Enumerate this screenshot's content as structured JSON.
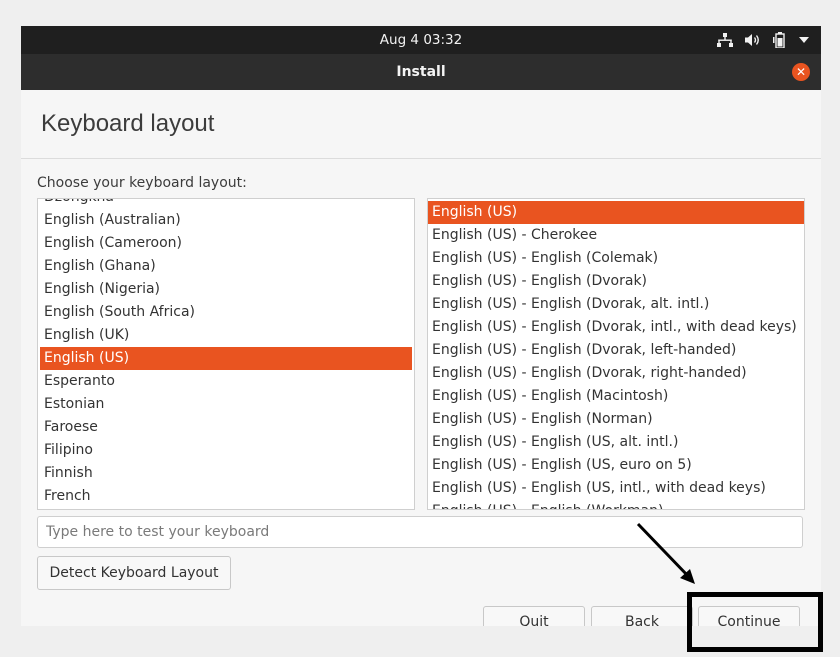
{
  "topbar": {
    "clock": "Aug 4  03:32",
    "icons": [
      "network-icon",
      "volume-icon",
      "battery-icon",
      "system-menu-chevron-icon"
    ]
  },
  "titlebar": {
    "title": "Install",
    "close_icon": "close-icon"
  },
  "page": {
    "title": "Keyboard layout",
    "prompt": "Choose your keyboard layout:"
  },
  "layouts": {
    "items": [
      "Dzongkha",
      "English (Australian)",
      "English (Cameroon)",
      "English (Ghana)",
      "English (Nigeria)",
      "English (South Africa)",
      "English (UK)",
      "English (US)",
      "Esperanto",
      "Estonian",
      "Faroese",
      "Filipino",
      "Finnish",
      "French"
    ],
    "selected": "English (US)"
  },
  "variants": {
    "items": [
      "English (US)",
      "English (US) - Cherokee",
      "English (US) - English (Colemak)",
      "English (US) - English (Dvorak)",
      "English (US) - English (Dvorak, alt. intl.)",
      "English (US) - English (Dvorak, intl., with dead keys)",
      "English (US) - English (Dvorak, left-handed)",
      "English (US) - English (Dvorak, right-handed)",
      "English (US) - English (Macintosh)",
      "English (US) - English (Norman)",
      "English (US) - English (US, alt. intl.)",
      "English (US) - English (US, euro on 5)",
      "English (US) - English (US, intl., with dead keys)",
      "English (US) - English (Workman)"
    ],
    "selected": "English (US)"
  },
  "test_input": {
    "placeholder": "Type here to test your keyboard",
    "value": ""
  },
  "buttons": {
    "detect": "Detect Keyboard Layout",
    "quit": "Quit",
    "back": "Back",
    "continue": "Continue"
  },
  "colors": {
    "accent": "#e95420",
    "topbar": "#1f1f1f",
    "titlebar": "#2d2d2d"
  }
}
